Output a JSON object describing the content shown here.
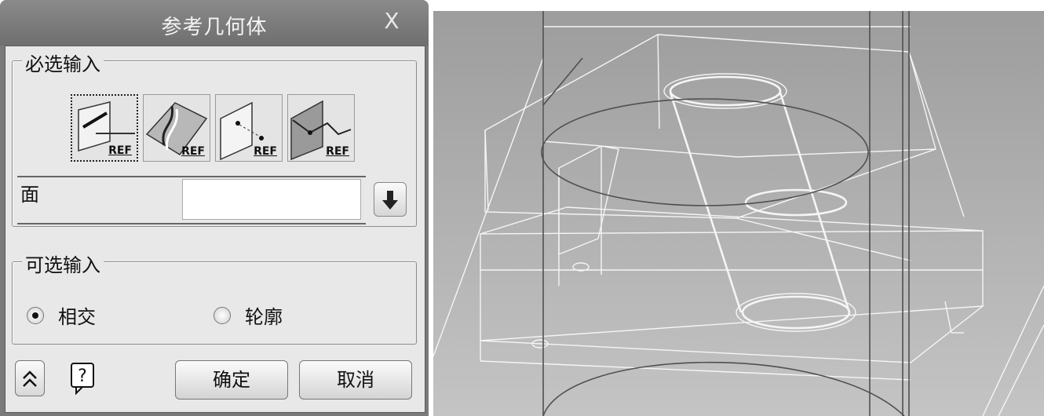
{
  "dialog": {
    "title": "参考几何体",
    "close_glyph": "X",
    "required_group": {
      "title": "必选输入",
      "ref_buttons": [
        {
          "icon": "edge-reference-icon",
          "tag": "REF"
        },
        {
          "icon": "surface-reference-icon",
          "tag": "REF"
        },
        {
          "icon": "plane-point-reference-icon",
          "tag": "REF"
        },
        {
          "icon": "plane-curve-reference-icon",
          "tag": "REF"
        }
      ],
      "face_label": "面",
      "face_value": ""
    },
    "optional_group": {
      "title": "可选输入",
      "options": [
        {
          "label": "相交",
          "selected": true
        },
        {
          "label": "轮廓",
          "selected": false
        }
      ]
    },
    "buttons": {
      "collapse_glyph": "⌃",
      "help_glyph": "?",
      "ok": "确定",
      "cancel": "取消"
    }
  }
}
